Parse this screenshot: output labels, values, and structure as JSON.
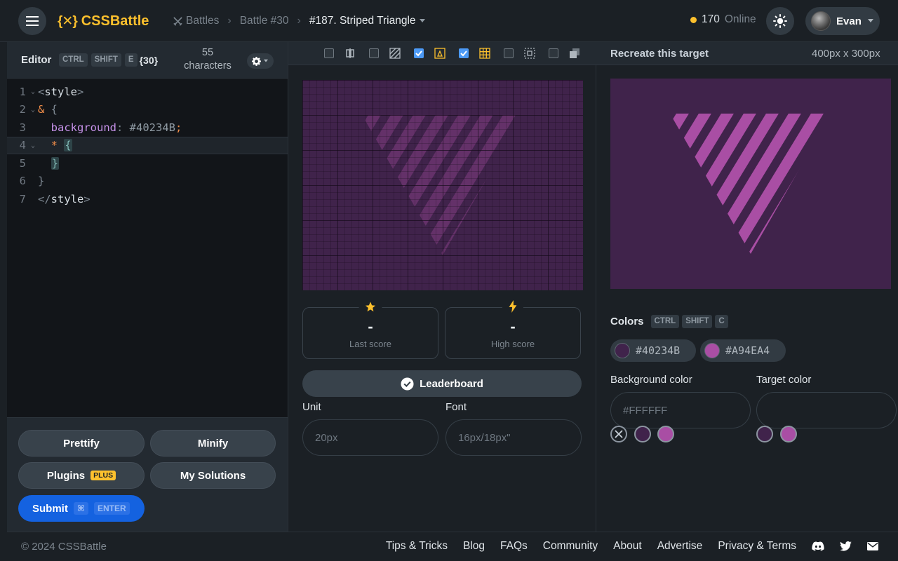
{
  "header": {
    "logo_text": "CSSBattle",
    "breadcrumb": {
      "battles": "Battles",
      "battle": "Battle #30",
      "current": "#187. Striped Triangle"
    },
    "online_count": "170",
    "online_label": "Online",
    "user_name": "Evan"
  },
  "editor": {
    "title": "Editor",
    "shortcut": [
      "CTRL",
      "SHIFT",
      "E"
    ],
    "char_value": "30",
    "char_count": "55",
    "char_label": "characters",
    "lines": [
      {
        "n": "1",
        "fold": true
      },
      {
        "n": "2",
        "fold": true
      },
      {
        "n": "3",
        "fold": false
      },
      {
        "n": "4",
        "fold": true
      },
      {
        "n": "5",
        "fold": false
      },
      {
        "n": "6",
        "fold": false
      },
      {
        "n": "7",
        "fold": false
      }
    ],
    "code": {
      "l1_open": "<",
      "l1_tag": "style",
      "l1_close": ">",
      "l2_amp": "&",
      "l2_brace": " {",
      "l3_prop": "background",
      "l3_colon": ":",
      "l3_val": " #40234B",
      "l3_semi": ";",
      "l4_star": "*",
      "l4_brace": "{",
      "l5_brace": "}",
      "l6_brace": "}",
      "l7_open": "</",
      "l7_tag": "style",
      "l7_close": ">"
    },
    "buttons": {
      "prettify": "Prettify",
      "minify": "Minify",
      "plugins": "Plugins",
      "plus_badge": "PLUS",
      "my_solutions": "My Solutions",
      "submit": "Submit",
      "submit_cmd": "⌘",
      "submit_key": "ENTER"
    }
  },
  "preview": {
    "toolbar_toggles": [
      false,
      false,
      true,
      true,
      false,
      false
    ],
    "last_score_value": "-",
    "last_score_label": "Last score",
    "high_score_value": "-",
    "high_score_label": "High score",
    "leaderboard": "Leaderboard",
    "unit_label": "Unit",
    "unit_placeholder": "20px",
    "font_label": "Font",
    "font_placeholder": "16px/18px\""
  },
  "target": {
    "title": "Recreate this target",
    "dimensions": "400px x 300px",
    "colors_title": "Colors",
    "colors_shortcut": [
      "CTRL",
      "SHIFT",
      "C"
    ],
    "colors": [
      {
        "hex": "#40234B"
      },
      {
        "hex": "#A94EA4"
      }
    ],
    "background_color_label": "Background color",
    "background_color_placeholder": "#FFFFFF",
    "target_color_label": "Target color",
    "target_color_placeholder": ""
  },
  "colors": {
    "bg": "#40234b",
    "fg": "#a94ea4",
    "accent_yellow": "#fcc02d",
    "submit_blue": "#1462e0",
    "checkbox_blue": "#4c9af6"
  },
  "footer": {
    "copyright": "© 2024 CSSBattle",
    "links": [
      "Tips & Tricks",
      "Blog",
      "FAQs",
      "Community",
      "About",
      "Advertise",
      "Privacy & Terms"
    ]
  }
}
